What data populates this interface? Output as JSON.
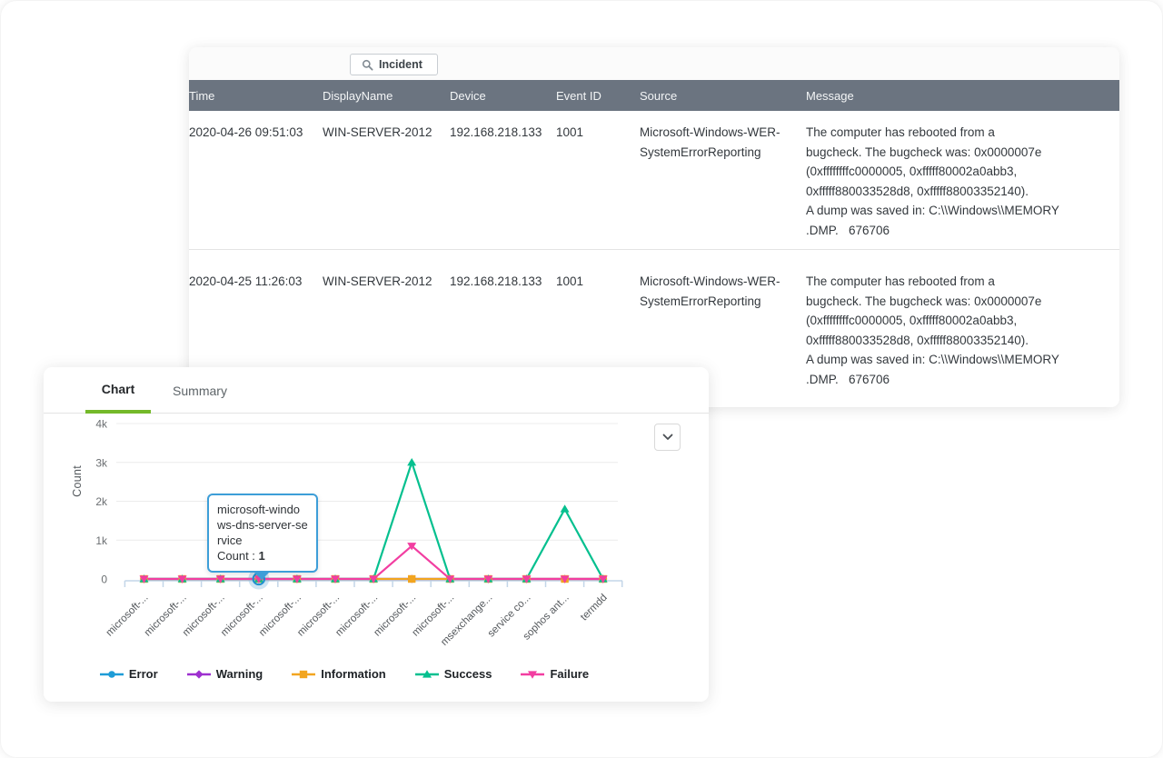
{
  "events_card": {
    "incident_button": {
      "label": "Incident",
      "icon": "magnifier-incident-icon"
    },
    "columns": [
      "Time",
      "DisplayName",
      "Device",
      "Event ID",
      "Source",
      "Message"
    ],
    "rows": [
      {
        "time": "2020-04-26 09:51:03",
        "display_name": "WIN-SERVER-2012",
        "device": "192.168.218.133",
        "event_id": "1001",
        "source_lines": [
          "Microsoft-Windows-WER-",
          "SystemErrorReporting"
        ],
        "message_lines": [
          "The computer has rebooted from a",
          "bugcheck. The bugcheck was: 0x0000007e",
          "(0xffffffffc0000005, 0xfffff80002a0abb3,",
          "0xfffff880033528d8, 0xfffff88003352140).",
          "A dump was saved in: C:\\\\Windows\\\\MEMORY",
          ".DMP.   676706"
        ]
      },
      {
        "time": "2020-04-25 11:26:03",
        "display_name": "WIN-SERVER-2012",
        "device": "192.168.218.133",
        "event_id": "1001",
        "source_lines": [
          "Microsoft-Windows-WER-",
          "SystemErrorReporting"
        ],
        "message_lines": [
          "The computer has rebooted from a",
          "bugcheck. The bugcheck was: 0x0000007e",
          "(0xffffffffc0000005, 0xfffff80002a0abb3,",
          "0xfffff880033528d8, 0xfffff88003352140).",
          "A dump was saved in: C:\\\\Windows\\\\MEMORY",
          ".DMP.   676706"
        ]
      }
    ]
  },
  "chart_card": {
    "tabs": [
      {
        "label": "Chart",
        "active": true
      },
      {
        "label": "Summary",
        "active": false
      }
    ],
    "accent_green": "#74b929",
    "dropdown_icon": "chevron-down-icon",
    "tooltip": {
      "service": "microsoft-windows-dns-server-service",
      "count_label": "Count : ",
      "count_value": "1"
    }
  },
  "chart_data": {
    "type": "line",
    "title": "",
    "xlabel": "",
    "ylabel": "Count",
    "ylim": [
      0,
      4000
    ],
    "ytick_labels": [
      "0",
      "1k",
      "2k",
      "3k",
      "4k"
    ],
    "grid": true,
    "legend_position": "bottom",
    "categories": [
      "microsoft-...",
      "microsoft-...",
      "microsoft-...",
      "microsoft-...",
      "microsoft-...",
      "microsoft-...",
      "microsoft-...",
      "microsoft-...",
      "microsoft-...",
      "msexchange...",
      "service co...",
      "sophos ant...",
      "termdd"
    ],
    "series": [
      {
        "name": "Error",
        "color": "#1e9cd7",
        "marker": "circle",
        "values": [
          0,
          0,
          0,
          1,
          0,
          0,
          0,
          0,
          0,
          0,
          0,
          0,
          0
        ]
      },
      {
        "name": "Warning",
        "color": "#9e30cf",
        "marker": "diamond",
        "values": [
          0,
          0,
          0,
          0,
          0,
          0,
          0,
          0,
          0,
          0,
          0,
          0,
          0
        ]
      },
      {
        "name": "Information",
        "color": "#f2a51f",
        "marker": "square",
        "values": [
          0,
          0,
          0,
          0,
          0,
          0,
          0,
          0,
          0,
          0,
          0,
          0,
          0
        ]
      },
      {
        "name": "Success",
        "color": "#06c08f",
        "marker": "triangle-up",
        "values": [
          0,
          0,
          0,
          0,
          0,
          0,
          0,
          3000,
          0,
          0,
          0,
          1800,
          0
        ]
      },
      {
        "name": "Failure",
        "color": "#f23ea1",
        "marker": "triangle-down",
        "values": [
          0,
          0,
          0,
          0,
          0,
          0,
          0,
          850,
          0,
          0,
          0,
          0,
          0
        ]
      }
    ],
    "highlighted_point": {
      "series": "Error",
      "category_index": 3,
      "value": 1
    }
  }
}
